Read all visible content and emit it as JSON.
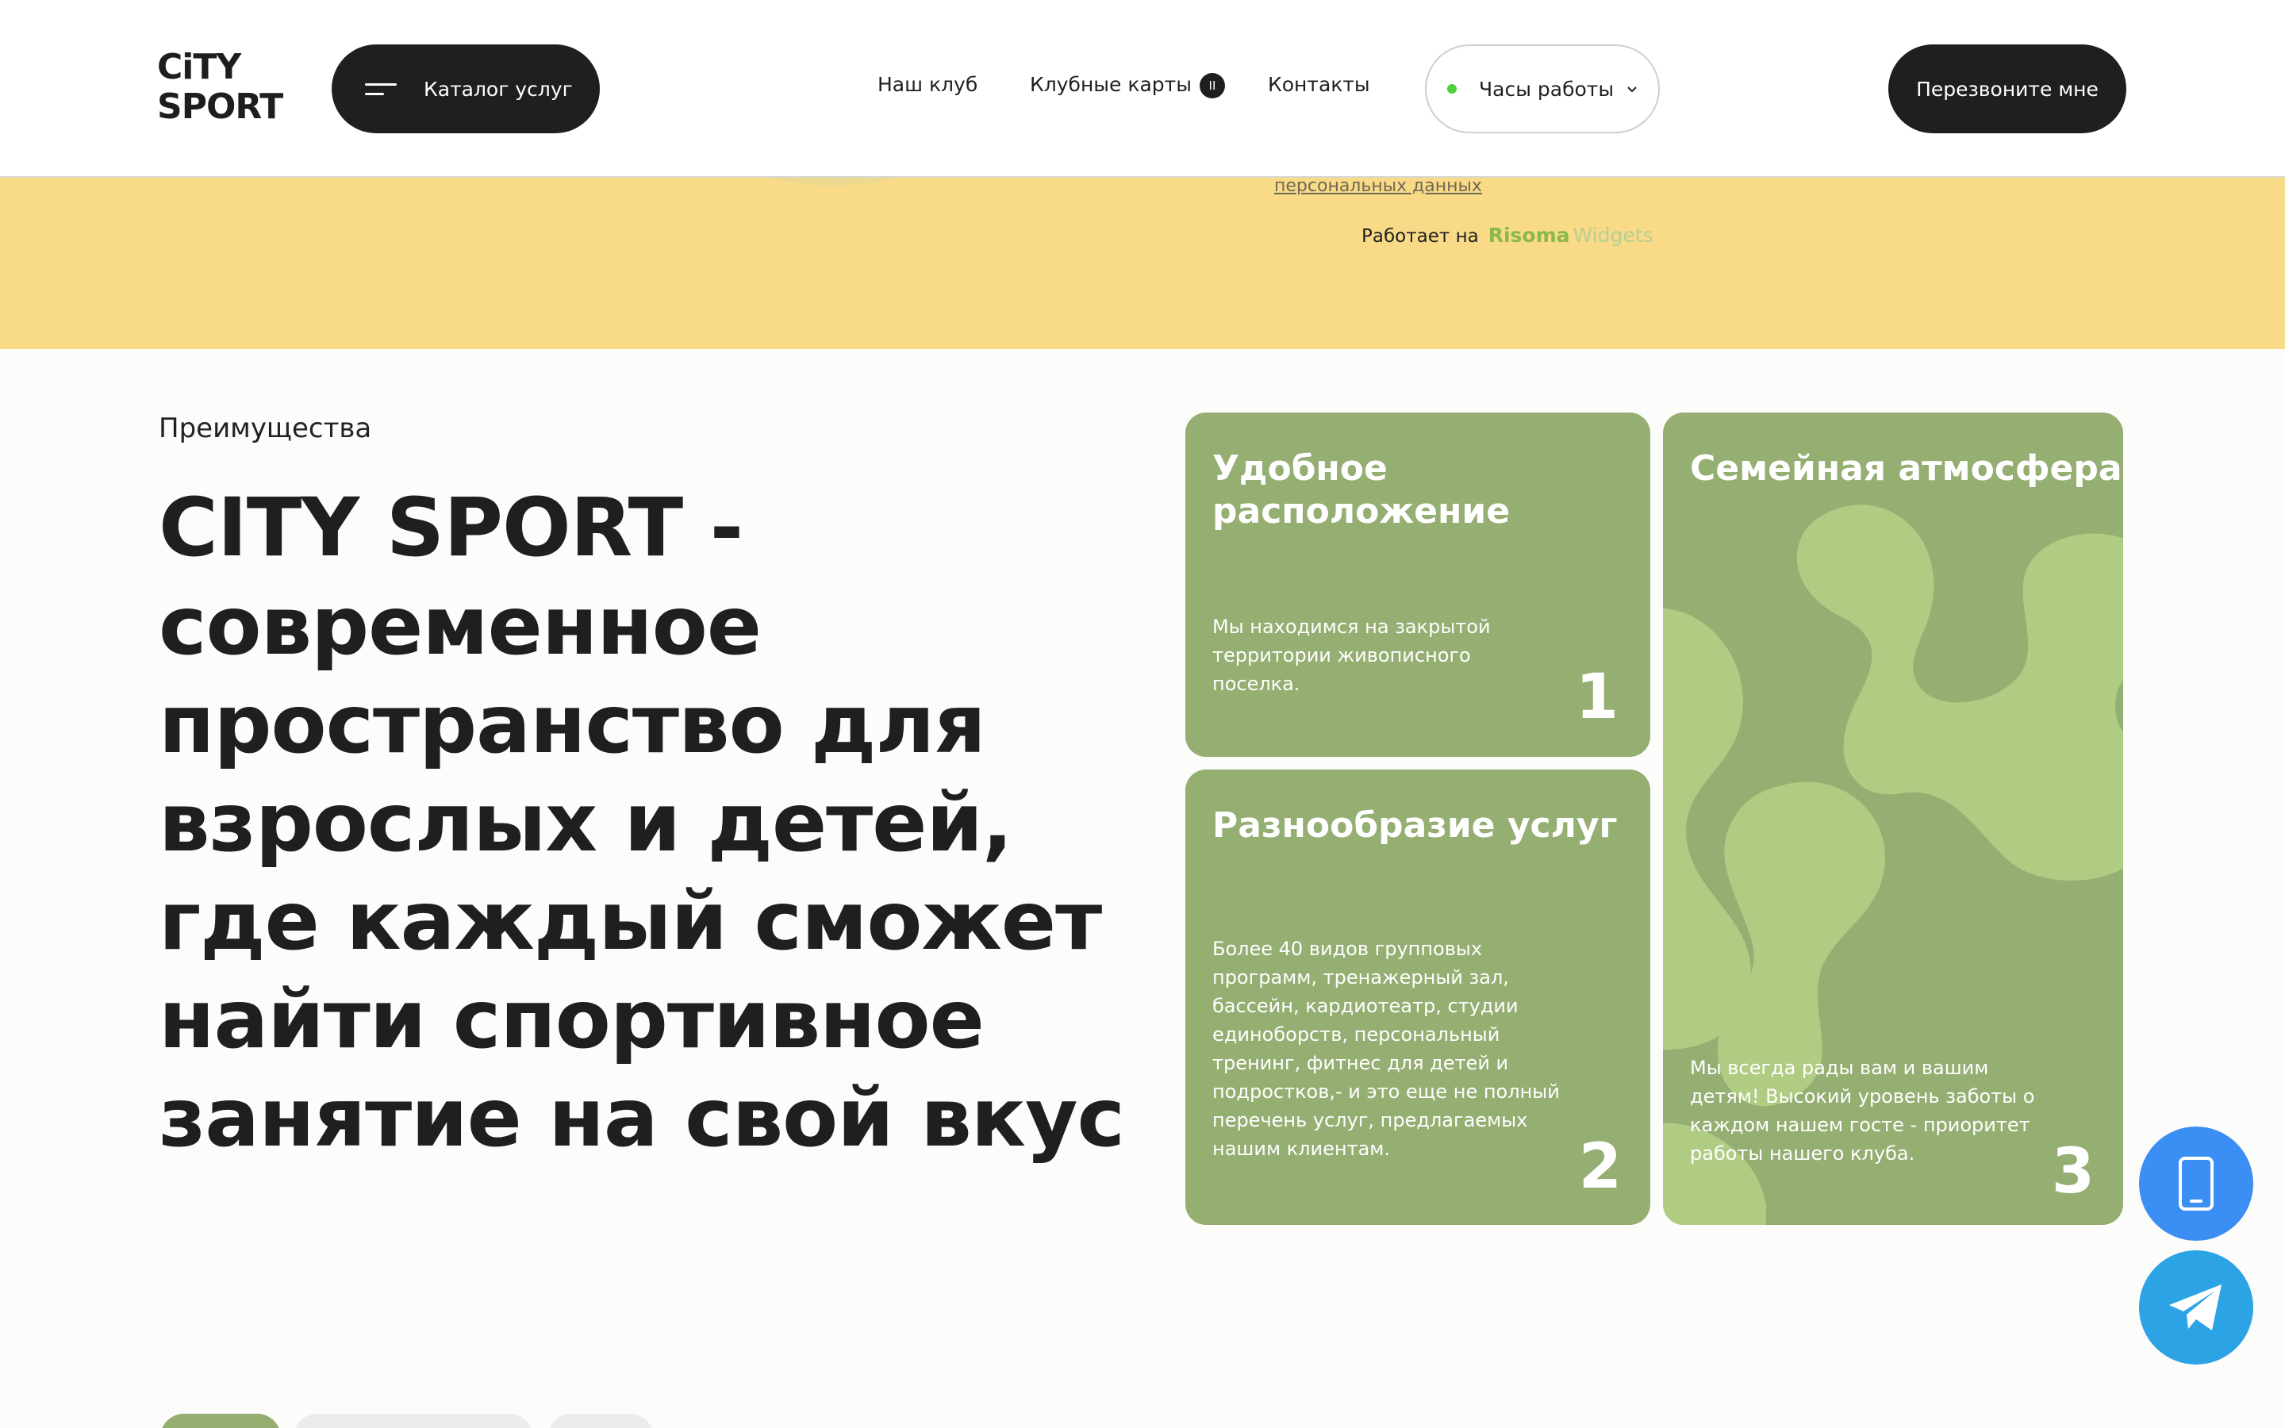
{
  "header": {
    "logo_line1": "CiTY",
    "logo_line2": "SPORT",
    "catalog_label": "Каталог услуг",
    "nav": [
      {
        "label": "Наш клуб"
      },
      {
        "label": "Клубные карты",
        "badge": "II"
      },
      {
        "label": "Контакты"
      }
    ],
    "hours_label": "Часы работы",
    "callback_label": "Перезвоните мне"
  },
  "band": {
    "privacy_link": "персональных данных",
    "powered_label": "Работает на",
    "powered_brand": "Risoma",
    "powered_product": "Widgets"
  },
  "advantages": {
    "section_label": "Преимущества",
    "headline_first": "CITY SPORT -",
    "headline_rest": "современное пространство для взрослых и детей, где каждый сможет найти спортивное занятие на свой вкус",
    "cards": [
      {
        "title": "Удобное расположение",
        "text": "Мы находимся на закрытой территории живописного поселка.",
        "number": "1"
      },
      {
        "title": "Разнообразие услуг",
        "text": "Более 40 видов групповых программ, тренажерный зал, бассейн, кардиотеатр, студии единоборств, персональный тренинг, фитнес для детей и подростков,- и это еще не полный перечень услуг, предлагаемых нашим клиентам.",
        "number": "2"
      },
      {
        "title": "Семейная атмосфера",
        "text": "Мы всегда рады вам и вашим детям! Высокий уровень заботы о каждом нашем госте - приоритет работы нашего клуба.",
        "number": "3"
      }
    ]
  },
  "colors": {
    "card_green": "#95ae72",
    "pattern_green": "#b0cc83",
    "band_yellow": "#f8da87",
    "dark": "#1f1f1f",
    "phone_fab": "#3a8ef4",
    "telegram_fab": "#2ba3e4"
  },
  "icons": {
    "menu": "burger-icon",
    "hours_status": "green-dot-icon",
    "hours_dropdown": "chevron-down-icon",
    "phone": "phone-icon",
    "telegram": "telegram-icon"
  }
}
